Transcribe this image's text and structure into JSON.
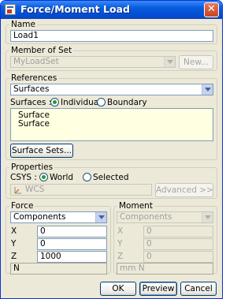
{
  "window": {
    "title": "Force/Moment Load",
    "close_symbol": "✕"
  },
  "name": {
    "legend": "Name",
    "value": "Load1"
  },
  "member_of_set": {
    "legend": "Member of Set",
    "value": "MyLoadSet",
    "new_button": "New..."
  },
  "references": {
    "legend": "References",
    "type_value": "Surfaces",
    "surfaces_label": "Surfaces :",
    "individual_label": "Individual",
    "boundary_label": "Boundary",
    "selected_mode": "Individual",
    "items": [
      "Surface",
      "Surface"
    ],
    "surface_sets_button": "Surface Sets..."
  },
  "properties": {
    "legend": "Properties",
    "csys_label": "CSYS :",
    "world_label": "World",
    "selected_label": "Selected",
    "selected_mode": "World",
    "csys_value": "WCS",
    "advanced_button": "Advanced >>"
  },
  "force": {
    "legend": "Force",
    "mode": "Components",
    "x_label": "X",
    "x_value": "0",
    "y_label": "Y",
    "y_value": "0",
    "z_label": "Z",
    "z_value": "1000",
    "units": "N"
  },
  "moment": {
    "legend": "Moment",
    "mode": "Components",
    "x_label": "X",
    "x_value": "0",
    "y_label": "Y",
    "y_value": "0",
    "z_label": "Z",
    "z_value": "0",
    "units": "mm N"
  },
  "footer": {
    "ok": "OK",
    "preview": "Preview",
    "cancel": "Cancel"
  },
  "colors": {
    "title_bar": "#0a5fe0",
    "dialog_bg": "#ece9d8",
    "list_bg": "#ffffe1",
    "radio_dot": "#21a121"
  }
}
